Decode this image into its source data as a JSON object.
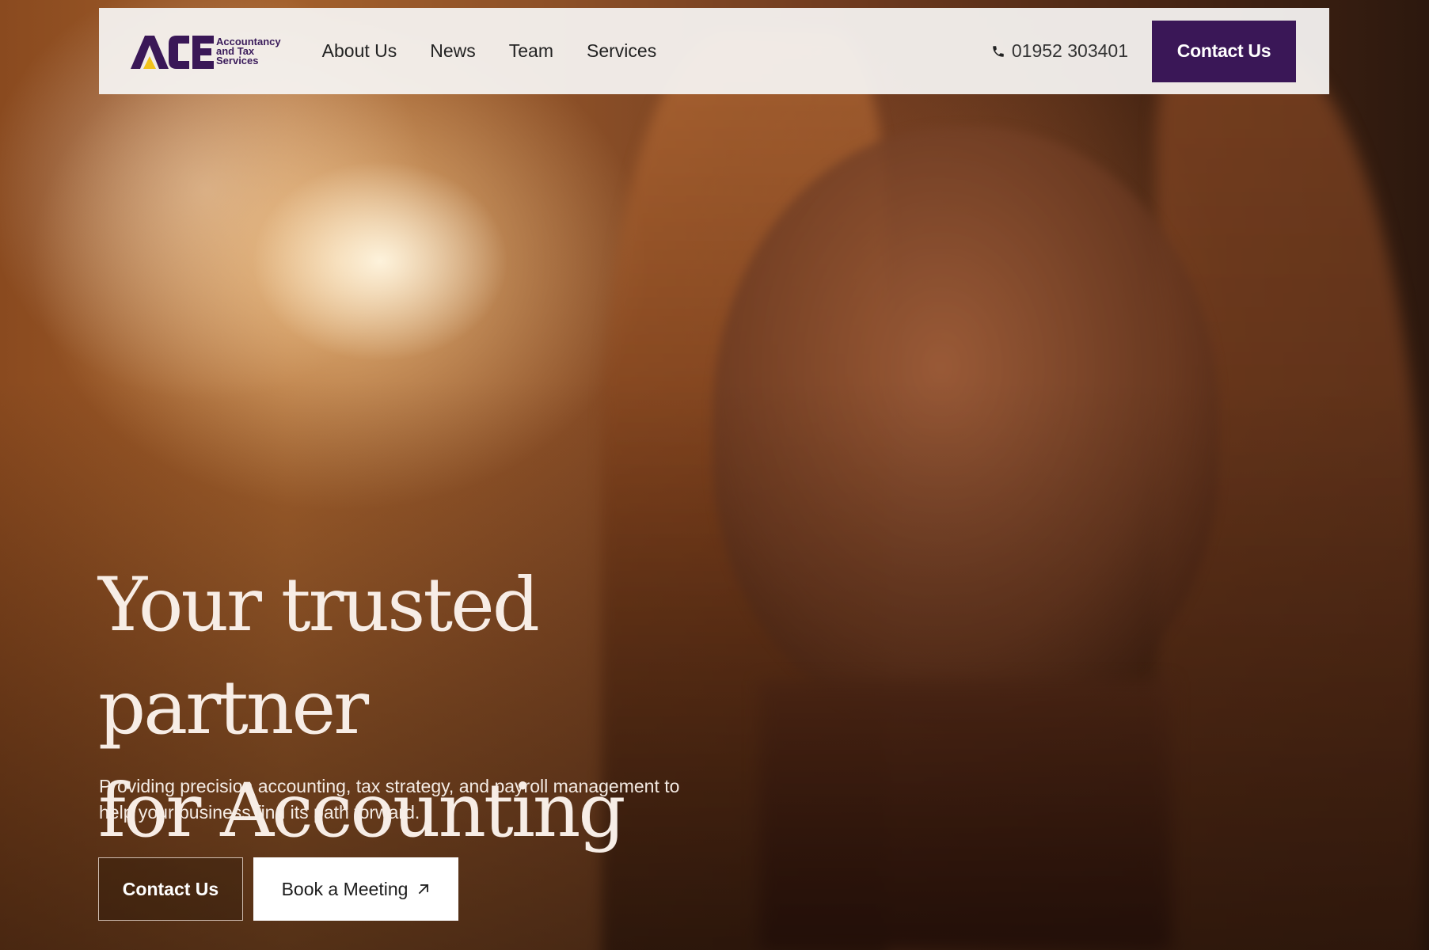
{
  "brand": {
    "logo_letters": "ACE",
    "logo_text_lines": [
      "Accountancy",
      "and Tax",
      "Services"
    ],
    "primary_color": "#3a1757",
    "accent_color": "#f2c21b"
  },
  "header": {
    "nav": [
      {
        "label": "About Us"
      },
      {
        "label": "News"
      },
      {
        "label": "Team"
      },
      {
        "label": "Services"
      }
    ],
    "phone": {
      "icon": "phone-icon",
      "number": "01952 303401"
    },
    "contact_label": "Contact Us"
  },
  "hero": {
    "title_line1": "Your trusted partner",
    "title_line2": "for Accounting",
    "subtitle_line1": "Providing precision accounting, tax strategy, and payroll management to",
    "subtitle_line2": "help your business find its path forward.",
    "cta_primary": "Contact Us",
    "cta_secondary": "Book a Meeting",
    "cta_secondary_icon": "arrow-up-right-icon"
  }
}
